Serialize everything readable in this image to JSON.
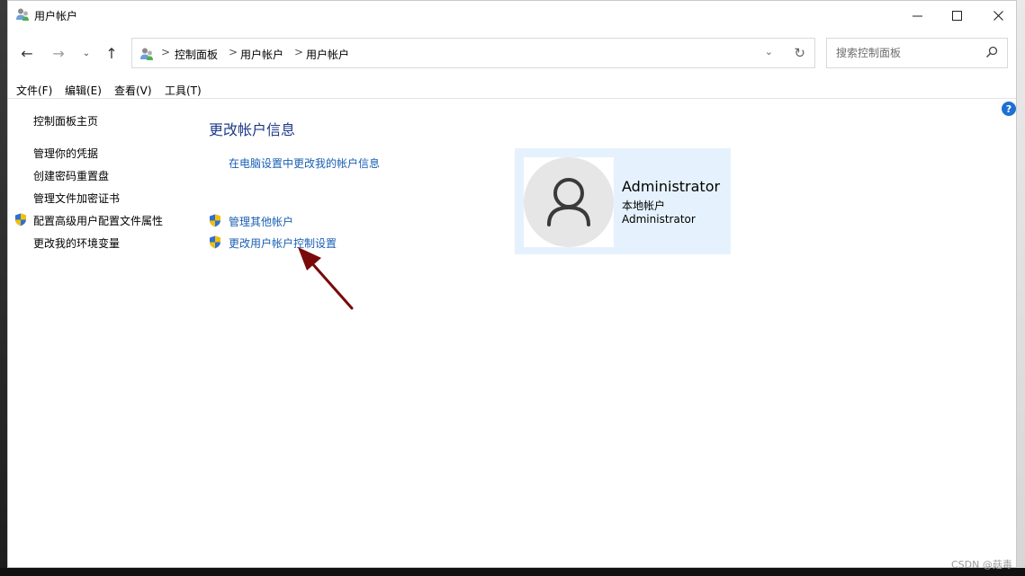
{
  "window": {
    "title": "用户帐户",
    "controls": {
      "minimize": "—",
      "maximize": "☐",
      "close": "✕"
    }
  },
  "nav": {
    "back": "←",
    "forward": "→",
    "recent": "⌄",
    "up": "↑",
    "breadcrumb": [
      "控制面板",
      "用户帐户",
      "用户帐户"
    ],
    "separator": ">",
    "refresh": "↻",
    "dropdown": "⌄"
  },
  "search": {
    "placeholder": "搜索控制面板"
  },
  "menu": [
    "文件(F)",
    "编辑(E)",
    "查看(V)",
    "工具(T)"
  ],
  "help": "?",
  "sidebar": {
    "items": [
      {
        "label": "控制面板主页",
        "shield": false
      },
      {
        "label": "管理你的凭据",
        "shield": false
      },
      {
        "label": "创建密码重置盘",
        "shield": false
      },
      {
        "label": "管理文件加密证书",
        "shield": false
      },
      {
        "label": "配置高级用户配置文件属性",
        "shield": true
      },
      {
        "label": "更改我的环境变量",
        "shield": false
      }
    ]
  },
  "main": {
    "title": "更改帐户信息",
    "links": [
      {
        "label": "在电脑设置中更改我的帐户信息",
        "shield": false
      },
      {
        "label": "管理其他帐户",
        "shield": true
      },
      {
        "label": "更改用户帐户控制设置",
        "shield": true
      }
    ]
  },
  "account": {
    "name": "Administrator",
    "type": "本地帐户",
    "username": "Administrator"
  },
  "watermark": "CSDN @菇毒",
  "colors": {
    "link": "#1a5fb4",
    "title": "#1e3a8a",
    "card": "#e5f2fd",
    "arrow": "#7a0a0a"
  }
}
